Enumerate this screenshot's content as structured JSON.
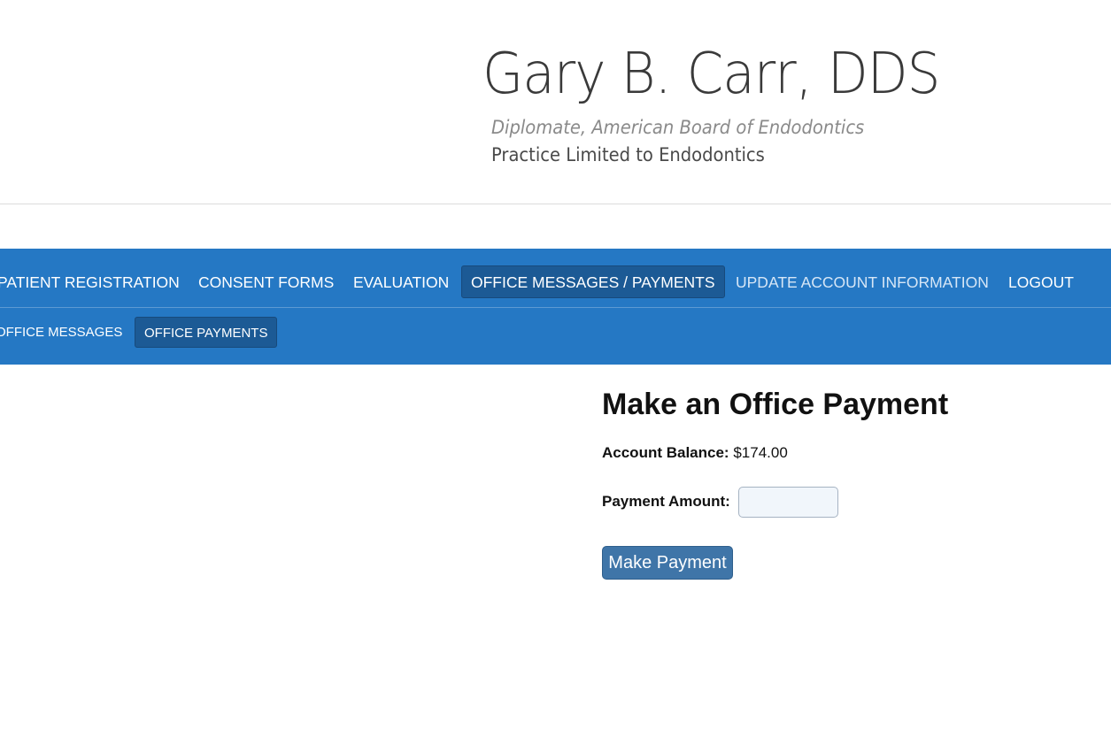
{
  "logo": {
    "title": "Gary B. Carr, DDS",
    "subtitle_1": "Diplomate, American Board of Endodontics",
    "subtitle_2": "Practice Limited to Endodontics"
  },
  "nav": {
    "items": [
      {
        "label": "PATIENT REGISTRATION"
      },
      {
        "label": "CONSENT FORMS"
      },
      {
        "label": "EVALUATION"
      },
      {
        "label": "OFFICE MESSAGES / PAYMENTS",
        "active": true
      },
      {
        "label": "UPDATE ACCOUNT INFORMATION"
      },
      {
        "label": "LOGOUT"
      }
    ],
    "sub_items": [
      {
        "label": "OFFICE MESSAGES"
      },
      {
        "label": "OFFICE PAYMENTS",
        "active": true
      }
    ]
  },
  "main": {
    "title": "Make an Office Payment",
    "balance_label": "Account Balance:",
    "balance_value": "$174.00",
    "payment_label": "Payment Amount:",
    "payment_value": "",
    "button_label": "Make Payment"
  },
  "colors": {
    "nav_background": "#2578c4",
    "nav_active": "#1c5a95",
    "button": "#3f75a8"
  }
}
